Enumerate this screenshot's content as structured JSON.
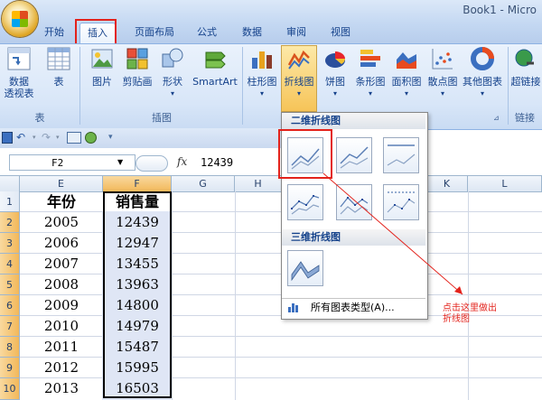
{
  "window": {
    "title": "Book1 - Micro"
  },
  "tabs": [
    "开始",
    "插入",
    "页面布局",
    "公式",
    "数据",
    "审阅",
    "视图"
  ],
  "active_tab": "插入",
  "ribbon": {
    "buttons": {
      "pivot": "数据\n透视表",
      "table": "表",
      "picture": "图片",
      "clipart": "剪贴画",
      "shapes": "形状",
      "smartart": "SmartArt",
      "column": "柱形图",
      "line": "折线图",
      "pie": "饼图",
      "bar": "条形图",
      "area": "面积图",
      "scatter": "散点图",
      "other": "其他图表",
      "hyperlink": "超链接"
    },
    "groups": {
      "tables": "表",
      "illustrations": "插图",
      "links": "链接"
    }
  },
  "formula_bar": {
    "name_box": "F2",
    "fx": "fx",
    "value": "12439"
  },
  "columns": [
    "E",
    "F",
    "G",
    "H",
    "K",
    "L"
  ],
  "rows": [
    "1",
    "2",
    "3",
    "4",
    "5",
    "6",
    "7",
    "8",
    "9",
    "10"
  ],
  "table": {
    "header_year": "年份",
    "header_sales": "销售量",
    "years": [
      "2005",
      "2006",
      "2007",
      "2008",
      "2009",
      "2010",
      "2011",
      "2012",
      "2013"
    ],
    "sales": [
      "12439",
      "12947",
      "13455",
      "13963",
      "14800",
      "14979",
      "15487",
      "15995",
      "16503"
    ]
  },
  "dropdown": {
    "section_2d": "二维折线图",
    "section_3d": "三维折线图",
    "all_chart_types": "所有图表类型(A)..."
  },
  "annotation": {
    "line1": "点击这里做出",
    "line2": "折线图"
  },
  "colors": {
    "highlight": "#e3221b",
    "ribbon": "#d8e6f8",
    "selection": "#f2b85a"
  }
}
